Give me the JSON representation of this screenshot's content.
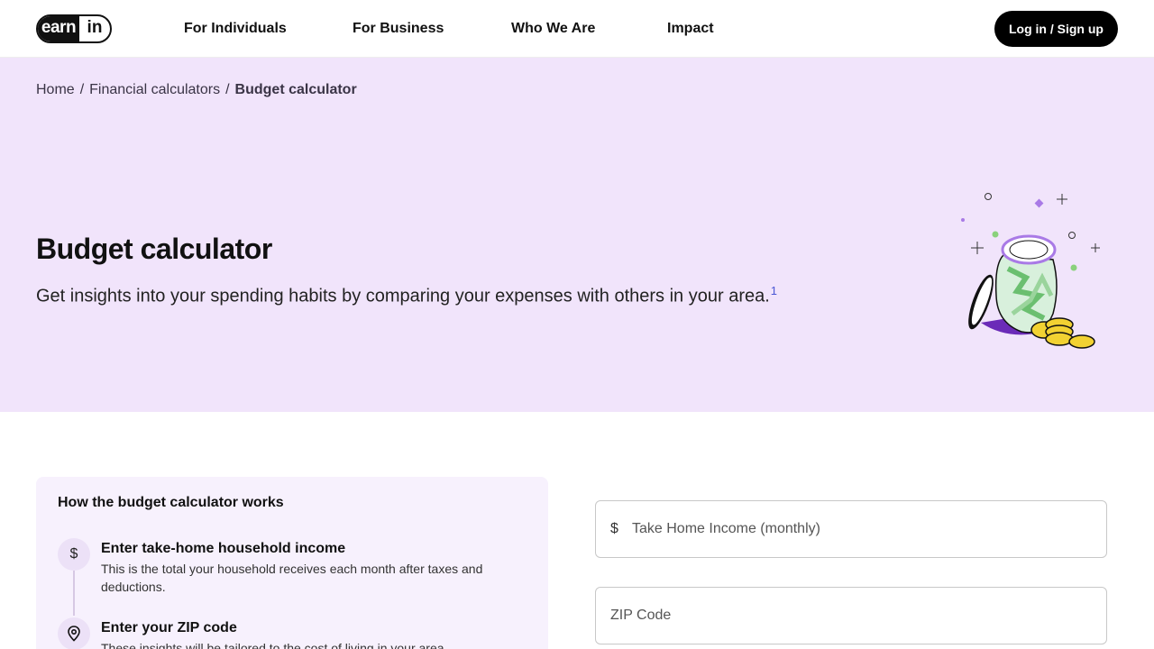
{
  "header": {
    "logo": {
      "part1": "earn",
      "part2": "in"
    },
    "nav": [
      "For Individuals",
      "For Business",
      "Who We Are",
      "Impact"
    ],
    "login_label": "Log in / Sign up"
  },
  "breadcrumb": {
    "home": "Home",
    "calculators": "Financial calculators",
    "current": "Budget calculator",
    "separator": "/"
  },
  "hero": {
    "title": "Budget calculator",
    "subtitle": "Get insights into your spending habits by comparing your expenses with others in your area.",
    "footnote": "1"
  },
  "howto": {
    "title": "How the budget calculator works",
    "steps": [
      {
        "icon": "dollar-icon",
        "symbol": "$",
        "title": "Enter take-home household income",
        "desc": "This is the total your household receives each month after taxes and deductions."
      },
      {
        "icon": "location-pin-icon",
        "title": "Enter your ZIP code",
        "desc": "These insights will be tailored to the cost of living in your area."
      }
    ]
  },
  "form": {
    "income": {
      "prefix": "$",
      "placeholder": "Take Home Income (monthly)"
    },
    "zip": {
      "placeholder": "ZIP Code"
    }
  },
  "colors": {
    "hero_bg": "#f1e4fb",
    "howto_bg": "#f7f1fd",
    "button_bg": "#000000",
    "footnote": "#4a57d4"
  }
}
